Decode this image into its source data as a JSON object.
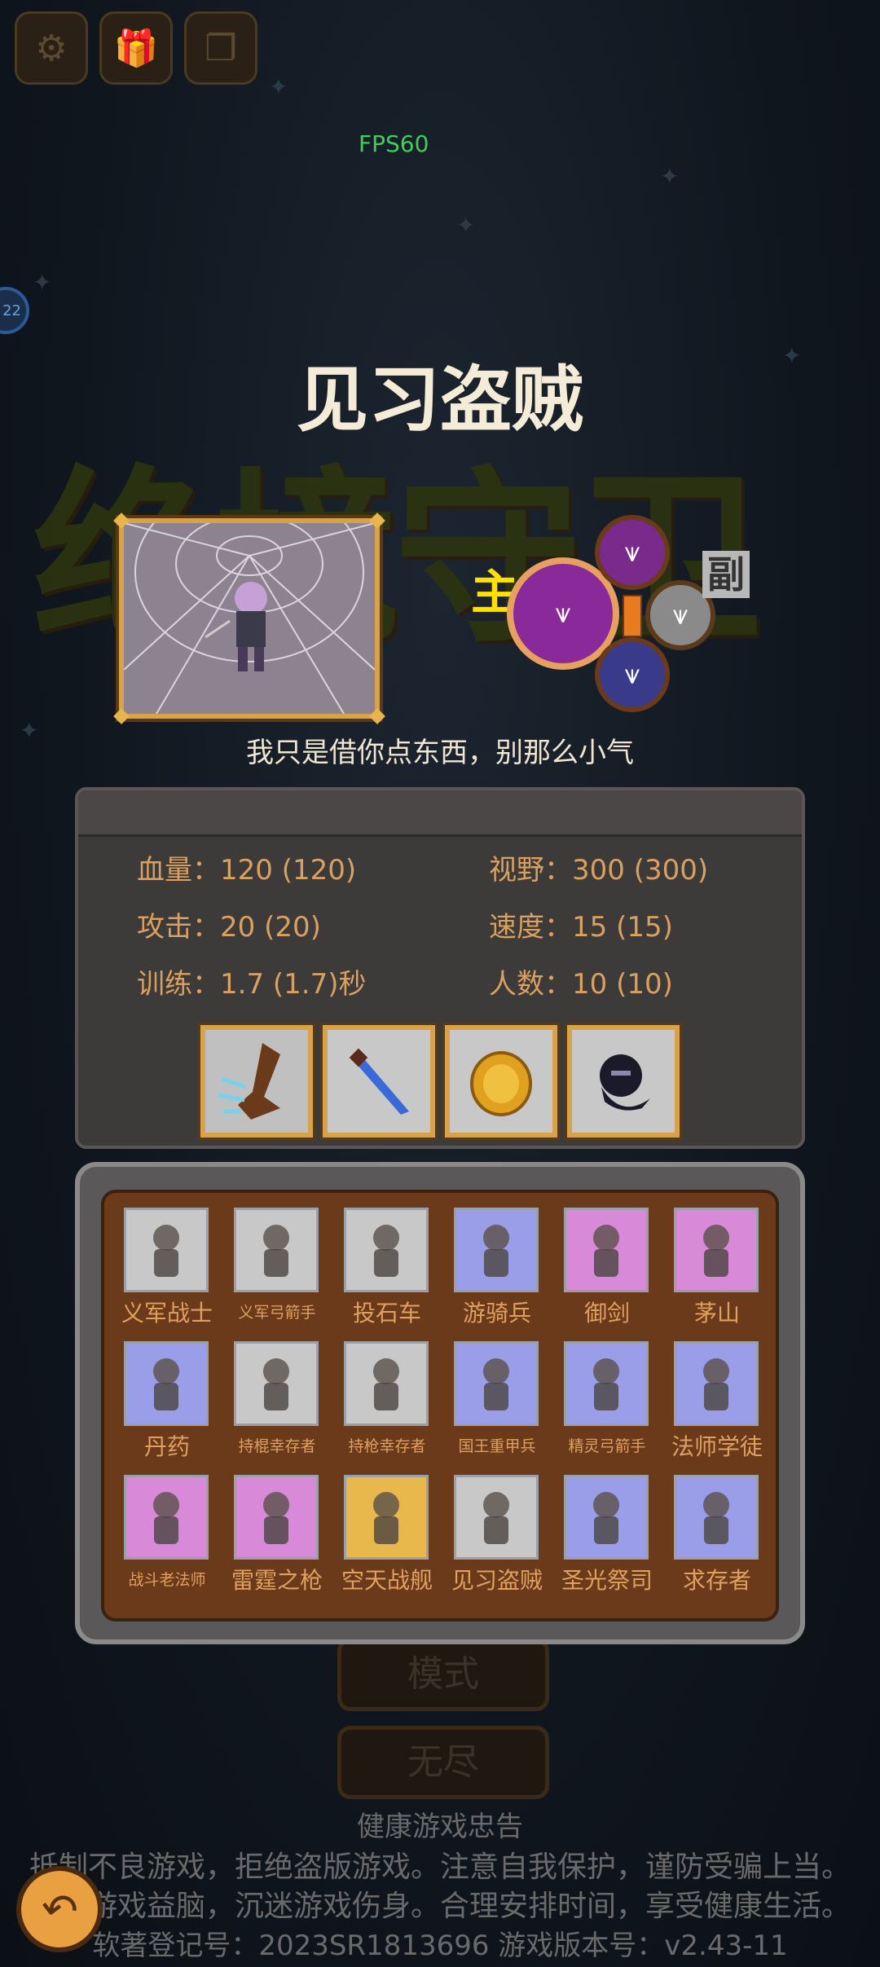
{
  "hud": {
    "fps": "FPS60",
    "side_badge": "22",
    "top_icons": [
      "gear-icon",
      "gift-icon",
      "copy-icon"
    ]
  },
  "background": {
    "game_title": "绝境守卫",
    "menu_buttons": [
      "模式",
      "无尽"
    ]
  },
  "unit": {
    "title": "见习盗贼",
    "quote": "我只是借你点东西，别那么小气",
    "main_label": "主",
    "sub_label": "副",
    "stats": [
      {
        "key": "血量：",
        "value": "120 (120)"
      },
      {
        "key": "视野：",
        "value": "300 (300)"
      },
      {
        "key": "攻击：",
        "value": "20 (20)"
      },
      {
        "key": "速度：",
        "value": "15 (15)"
      },
      {
        "key": "训练：",
        "value": "1.7 (1.7)秒"
      },
      {
        "key": "人数：",
        "value": "10 (10)"
      }
    ],
    "skills": [
      "speed-boot-icon",
      "dagger-icon",
      "gold-coin-icon",
      "shadow-thief-icon"
    ],
    "talents": [
      "talent-main-icon",
      "talent-top-icon",
      "talent-right-icon",
      "talent-bottom-icon"
    ]
  },
  "roster": [
    {
      "name": "义军战士",
      "bg": "#c8c8c8"
    },
    {
      "name": "义军弓箭手",
      "bg": "#c8c8c8"
    },
    {
      "name": "投石车",
      "bg": "#c8c8c8"
    },
    {
      "name": "游骑兵",
      "bg": "#9a9ee8"
    },
    {
      "name": "御剑",
      "bg": "#d88ad8"
    },
    {
      "name": "茅山",
      "bg": "#d88ad8"
    },
    {
      "name": "丹药",
      "bg": "#9a9ee8"
    },
    {
      "name": "持棍幸存者",
      "bg": "#c8c8c8"
    },
    {
      "name": "持枪幸存者",
      "bg": "#c8c8c8"
    },
    {
      "name": "国王重甲兵",
      "bg": "#9a9ee8"
    },
    {
      "name": "精灵弓箭手",
      "bg": "#9a9ee8"
    },
    {
      "name": "法师学徒",
      "bg": "#9a9ee8"
    },
    {
      "name": "战斗老法师",
      "bg": "#d88ad8"
    },
    {
      "name": "雷霆之枪",
      "bg": "#d88ad8"
    },
    {
      "name": "空天战舰",
      "bg": "#e8b84c"
    },
    {
      "name": "见习盗贼",
      "bg": "#c8c8c8"
    },
    {
      "name": "圣光祭司",
      "bg": "#9a9ee8"
    },
    {
      "name": "求存者",
      "bg": "#9a9ee8"
    }
  ],
  "footer": {
    "heading": "健康游戏忠告",
    "line1": "抵制不良游戏，拒绝盗版游戏。注意自我保护，谨防受骗上当。",
    "line2": "适度游戏益脑，沉迷游戏伤身。合理安排时间，享受健康生活。",
    "line3": "软著登记号：2023SR1813696    游戏版本号：v2.43-11"
  }
}
